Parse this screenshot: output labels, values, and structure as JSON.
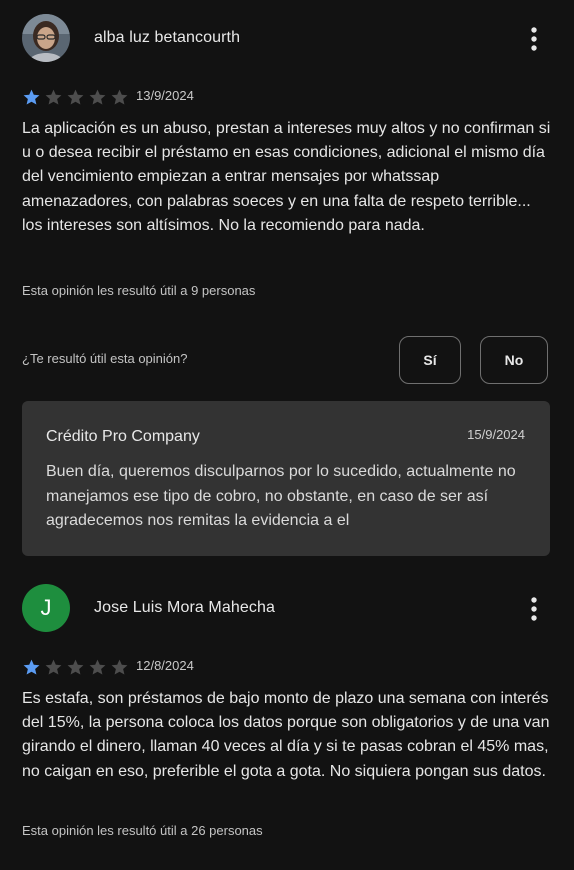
{
  "reviews": [
    {
      "author": "alba luz betancourth",
      "avatar_icon": "profile-photo",
      "rating": 1,
      "max_rating": 5,
      "date": "13/9/2024",
      "text": "La aplicación es un abuso, prestan a intereses muy altos y no confirman si u o desea recibir el préstamo en esas condiciones, adicional el mismo día del vencimiento empiezan a entrar mensajes por whatssap amenazadores, con palabras soeces y en una falta de respeto terrible... los intereses son altísimos. No la recomiendo para nada.",
      "helpful_text": "Esta opinión les resultó útil a 9 personas",
      "helpful_question": "¿Te resultó útil esta opinión?",
      "yes_label": "Sí",
      "no_label": "No",
      "developer_reply": {
        "name": "Crédito Pro Company",
        "date": "15/9/2024",
        "text": "Buen día, queremos disculparnos por lo sucedido, actualmente no manejamos ese tipo de cobro, no obstante, en caso de ser así agradecemos nos remitas la evidencia a el"
      }
    },
    {
      "author": "Jose Luis Mora Mahecha",
      "avatar_letter": "J",
      "rating": 1,
      "max_rating": 5,
      "date": "12/8/2024",
      "text": "Es estafa, son préstamos de bajo monto de plazo una semana con interés del 15%, la persona coloca los datos porque son obligatorios y de una van girando el dinero, llaman 40 veces al día y si te pasas cobran el 45% mas, no caigan en eso, preferible el gota a gota. No siquiera pongan sus datos.",
      "helpful_text": "Esta opinión les resultó útil a 26 personas"
    }
  ],
  "colors": {
    "background": "#121212",
    "star_filled": "#5b9cf3",
    "star_empty": "#4d4d4d",
    "reply_background": "#333333",
    "avatar_letter_bg": "#1e8e3e"
  }
}
